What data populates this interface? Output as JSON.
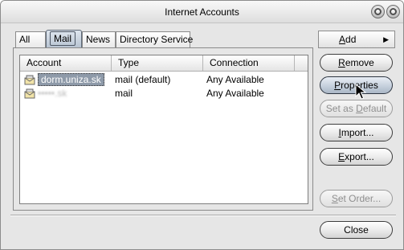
{
  "window": {
    "title": "Internet Accounts"
  },
  "tabs": [
    {
      "label": "All"
    },
    {
      "label": "Mail"
    },
    {
      "label": "News"
    },
    {
      "label": "Directory Service"
    }
  ],
  "table": {
    "columns": [
      "Account",
      "Type",
      "Connection"
    ],
    "rows": [
      {
        "account": "dorm.uniza.sk",
        "type": "mail (default)",
        "connection": "Any Available"
      },
      {
        "account": "•••••.sk",
        "type": "mail",
        "connection": "Any Available"
      }
    ]
  },
  "buttons": {
    "add": {
      "prefix": "",
      "mnemonic": "A",
      "rest": "dd"
    },
    "remove": {
      "prefix": "",
      "mnemonic": "R",
      "rest": "emove"
    },
    "properties": {
      "prefix": "",
      "mnemonic": "P",
      "rest": "roperties"
    },
    "set_default": {
      "prefix": "Set as ",
      "mnemonic": "D",
      "rest": "efault"
    },
    "import": {
      "prefix": "",
      "mnemonic": "I",
      "rest": "mport..."
    },
    "export": {
      "prefix": "",
      "mnemonic": "E",
      "rest": "xport..."
    },
    "set_order": {
      "prefix": "",
      "mnemonic": "S",
      "rest": "et Order..."
    },
    "close": {
      "prefix": "Close",
      "mnemonic": "",
      "rest": ""
    }
  },
  "icons": {
    "minimize": "minimize-icon",
    "close": "close-icon",
    "account": "mail-account-icon",
    "menu_arrow": "arrow-right-icon",
    "cursor": "mouse-pointer-icon"
  },
  "colors": {
    "window_bg": "#e6e6e6",
    "selection": "#8e9aa9",
    "disabled_text": "#8f8f8f"
  }
}
